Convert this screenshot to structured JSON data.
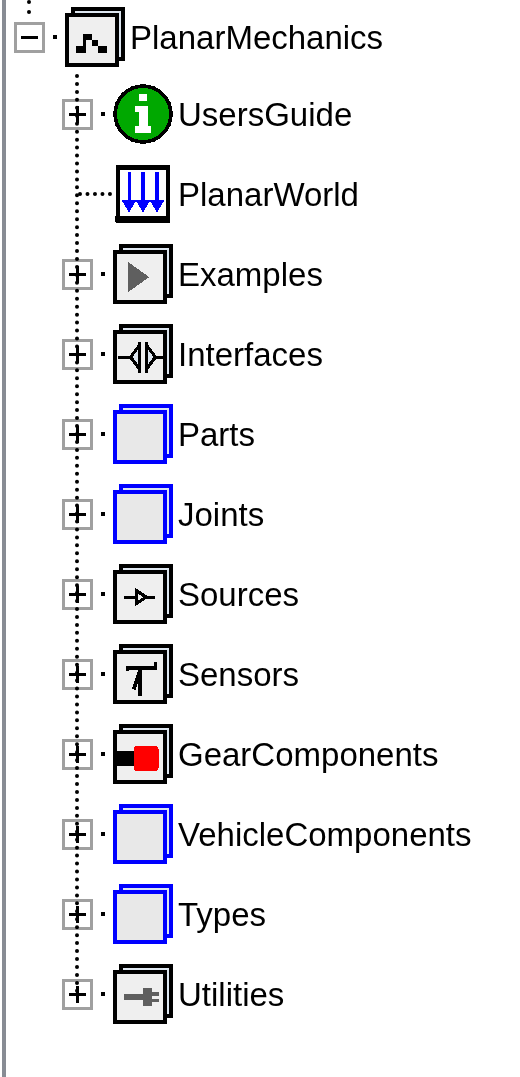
{
  "tree": {
    "label": "PlanarMechanics",
    "kind": "library",
    "expanded": true,
    "children": [
      {
        "label": "UsersGuide",
        "kind": "info",
        "expanded": false
      },
      {
        "label": "PlanarWorld",
        "kind": "world"
      },
      {
        "label": "Examples",
        "kind": "examples",
        "expanded": false
      },
      {
        "label": "Interfaces",
        "kind": "interfaces",
        "expanded": false
      },
      {
        "label": "Parts",
        "kind": "package",
        "expanded": false
      },
      {
        "label": "Joints",
        "kind": "package",
        "expanded": false
      },
      {
        "label": "Sources",
        "kind": "sources",
        "expanded": false
      },
      {
        "label": "Sensors",
        "kind": "sensors",
        "expanded": false
      },
      {
        "label": "GearComponents",
        "kind": "gear",
        "expanded": false
      },
      {
        "label": "VehicleComponents",
        "kind": "package",
        "expanded": false
      },
      {
        "label": "Types",
        "kind": "package",
        "expanded": false
      },
      {
        "label": "Utilities",
        "kind": "utilities",
        "expanded": false
      }
    ]
  }
}
